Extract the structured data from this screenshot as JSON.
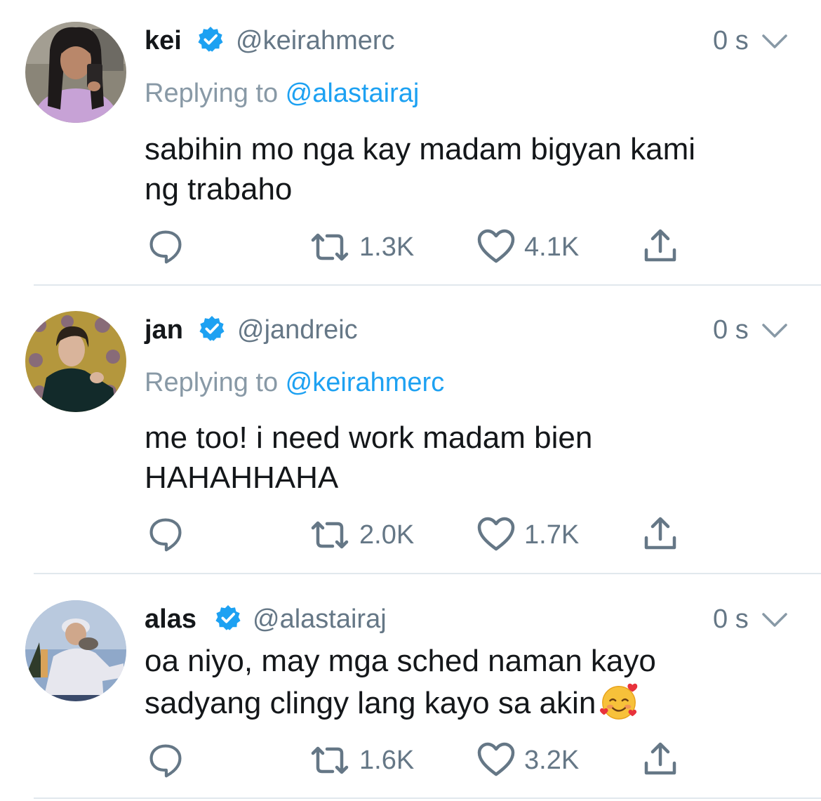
{
  "tweets": [
    {
      "name": "kei",
      "handle": "@keirahmerc",
      "time": "0 s",
      "replying_prefix": "Replying to ",
      "replying_to": "@alastairaj",
      "text_lines": [
        "sabihin mo nga kay madam bigyan kami",
        "ng trabaho"
      ],
      "retweets": "1.3K",
      "likes": "4.1K"
    },
    {
      "name": "jan",
      "handle": "@jandreic",
      "time": "0 s",
      "replying_prefix": "Replying to ",
      "replying_to": "@keirahmerc",
      "text_lines": [
        "me too! i need work madam bien",
        "HAHAHHAHA"
      ],
      "retweets": "2.0K",
      "likes": "1.7K"
    },
    {
      "name": "alas",
      "handle": "@alastairaj",
      "time": "0 s",
      "text_lines": [
        "oa niyo, may mga sched naman kayo",
        "sadyang clingy lang kayo sa akin"
      ],
      "emoji": "smiling-face-with-hearts",
      "retweets": "1.6K",
      "likes": "3.2K"
    }
  ],
  "colors": {
    "link": "#1da1f2",
    "verified": "#1da1f2",
    "secondary_text": "#657786",
    "divider": "#e1e8ed"
  },
  "icons": [
    "reply-icon",
    "retweet-icon",
    "like-icon",
    "share-icon",
    "verified-badge-icon",
    "chevron-down-icon"
  ]
}
